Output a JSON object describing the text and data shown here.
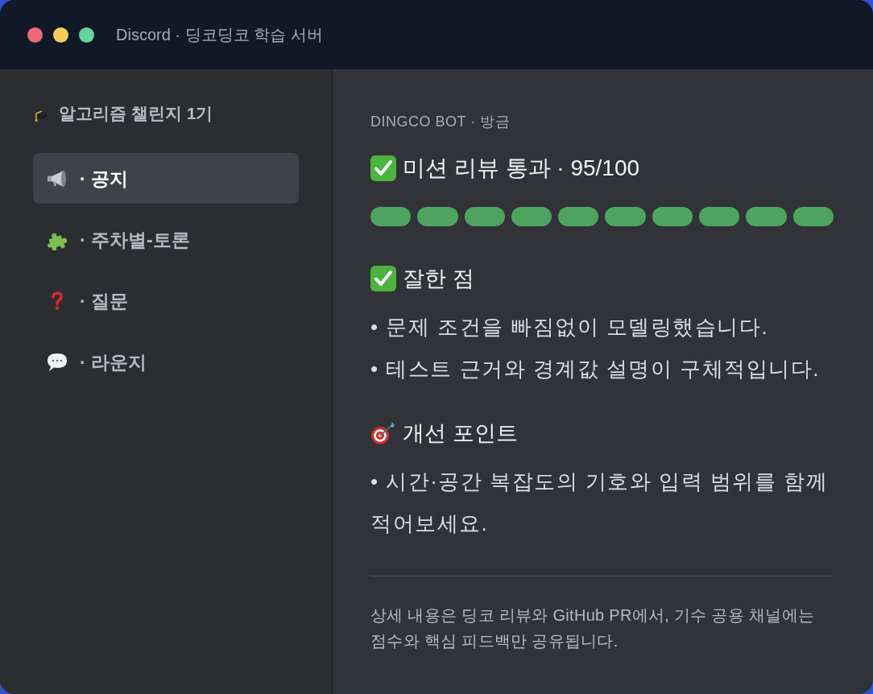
{
  "window": {
    "title": "Discord · 딩코딩코 학습 서버"
  },
  "sidebar": {
    "server_name": "알고리즘 챌린지 1기",
    "channels": [
      {
        "kind": "announcement",
        "label": "· 공지",
        "selected": true
      },
      {
        "kind": "discussion",
        "label": "· 주차별-토론",
        "selected": false
      },
      {
        "kind": "question",
        "label": "· 질문",
        "selected": false
      },
      {
        "kind": "chat",
        "label": "· 라운지",
        "selected": false
      }
    ]
  },
  "message": {
    "author": "DINGCO BOT · 방금",
    "title": "미션 리뷰 통과 · 95/100",
    "score_segments": [
      {
        "filled": true
      },
      {
        "filled": true
      },
      {
        "filled": true
      },
      {
        "filled": true
      },
      {
        "filled": true
      },
      {
        "filled": true
      },
      {
        "filled": true
      },
      {
        "filled": true
      },
      {
        "filled": true
      },
      {
        "filled": true
      }
    ],
    "sections": [
      {
        "kind": "strengths",
        "heading": "잘한 점",
        "bullets": [
          "• 문제 조건을 빠짐없이 모델링했습니다.",
          "• 테스트 근거와 경계값 설명이 구체적입니다."
        ]
      },
      {
        "kind": "improvements",
        "heading": "개선 포인트",
        "bullets": [
          "• 시간·공간 복잡도의 기호와 입력 범위를 함께 적어보세요."
        ]
      }
    ],
    "footer": "상세 내용은 딩코 리뷰와 GitHub PR에서, 기수 공용 채널에는 점수와 핵심 피드백만 공유됩니다."
  }
}
